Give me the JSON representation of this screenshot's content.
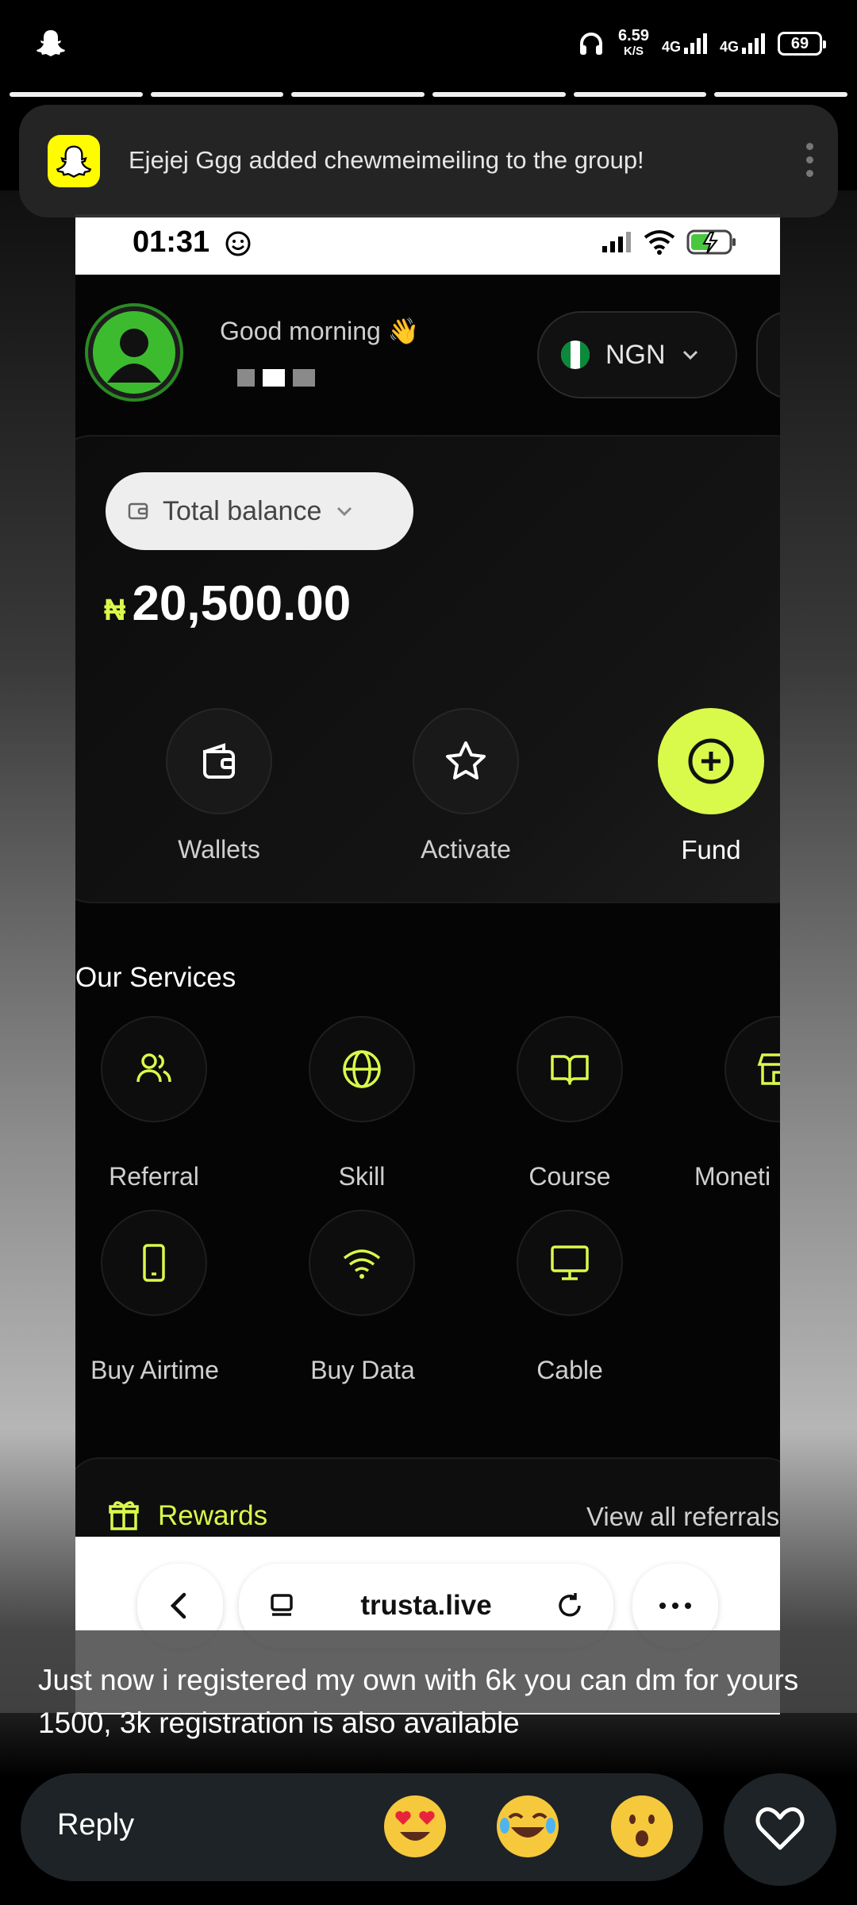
{
  "status_bar": {
    "speed_value": "6.59",
    "speed_unit": "K/S",
    "network_1": "4G",
    "network_2": "4G",
    "battery": "69"
  },
  "notification": {
    "app": "Snapchat",
    "text": "Ejejej Ggg added chewmeimeiling to the group!"
  },
  "shared_screenshot": {
    "time": "01:31",
    "greeting": "Good morning 👋",
    "currency": "NGN",
    "balance_label": "Total balance",
    "balance_symbol": "₦",
    "balance_value": "20,500.00",
    "actions": [
      {
        "label": "Wallets",
        "icon": "wallet-icon"
      },
      {
        "label": "Activate",
        "icon": "star-icon"
      },
      {
        "label": "Fund",
        "icon": "plus-circle-icon"
      }
    ],
    "services_title": "Our Services",
    "services": [
      {
        "label": "Referral",
        "icon": "users-icon"
      },
      {
        "label": "Skill",
        "icon": "globe-icon"
      },
      {
        "label": "Course",
        "icon": "book-icon"
      },
      {
        "label": "Moneti",
        "icon": "store-icon"
      },
      {
        "label": "Buy Airtime",
        "icon": "phone-icon"
      },
      {
        "label": "Buy Data",
        "icon": "wifi-icon"
      },
      {
        "label": "Cable",
        "icon": "monitor-icon"
      }
    ],
    "rewards_label": "Rewards",
    "view_referrals": "View all referrals",
    "url": "trusta.live",
    "accent_color": "#d9f94b"
  },
  "caption": "Just now i registered my own with 6k you can dm for yours 1500, 3k registration is also available",
  "reply": {
    "placeholder": "Reply",
    "emojis": [
      "😍",
      "😂",
      "😮"
    ]
  }
}
